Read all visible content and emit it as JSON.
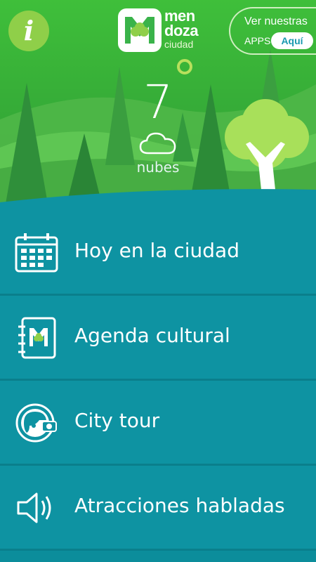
{
  "header": {
    "info_button_glyph": "i",
    "logo": {
      "line1": "men",
      "line2": "doza",
      "line3": "ciudad"
    },
    "apps": {
      "title": "Ver nuestras",
      "subtitle": "APPS",
      "button": "Aquí"
    }
  },
  "weather": {
    "temperature": "7",
    "condition": "nubes",
    "icon": "cloud-icon"
  },
  "menu": {
    "items": [
      {
        "label": "Hoy en la ciudad",
        "icon": "calendar-icon"
      },
      {
        "label": "Agenda cultural",
        "icon": "agenda-icon"
      },
      {
        "label": "City tour",
        "icon": "city-tour-icon"
      },
      {
        "label": "Atracciones habladas",
        "icon": "speaker-icon"
      }
    ]
  },
  "colors": {
    "teal": "#0e93a2",
    "green_light": "#8fcf49",
    "green_dark": "#2e8b2e"
  }
}
